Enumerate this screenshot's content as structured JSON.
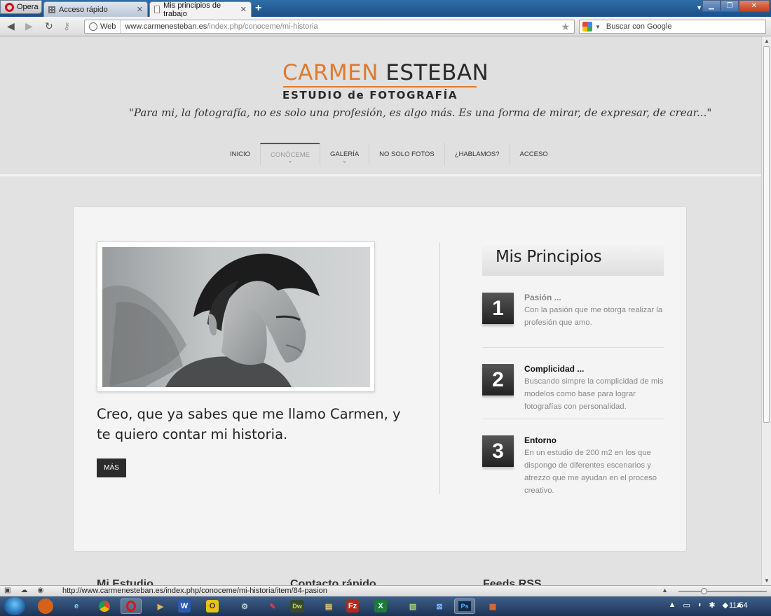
{
  "browser": {
    "menu_label": "Opera",
    "tabs": [
      {
        "label": "Acceso rápido"
      },
      {
        "label": "Mis principios de trabajo"
      }
    ],
    "address": {
      "badge": "Web",
      "url_host": "www.carmenesteban.es",
      "url_path": "/index.php/conoceme/mi-historia"
    },
    "search_placeholder": "Buscar con Google",
    "status_url": "http://www.carmenesteban.es/index.php/conoceme/mi-historia/item/84-pasion"
  },
  "site": {
    "logo_first": "CARMEN",
    "logo_last": "ESTEBAN",
    "logo_sub": "ESTUDIO de FOTOGRAFÍA",
    "tagline": "\"Para mi, la fotografía, no es solo una profesión, es algo más. Es una forma de mirar, de expresar, de crear...\"",
    "menu": [
      {
        "label": "INICIO"
      },
      {
        "label": "CONÓCEME"
      },
      {
        "label": "GALERÍA"
      },
      {
        "label": "NO SOLO FOTOS"
      },
      {
        "label": "¿HABLAMOS?"
      },
      {
        "label": "ACCESO"
      }
    ]
  },
  "main": {
    "intro": "Creo, que ya sabes que me llamo Carmen, y te quiero contar mi historia.",
    "more_button": "MÁS",
    "principles_title": "Mis Principios",
    "principles": [
      {
        "num": "1",
        "title": "Pasión ...",
        "text": "Con la pasión que me otorga realizar la profesión que amo."
      },
      {
        "num": "2",
        "title": "Complicidad ...",
        "text": "Buscando simpre la complicidad de mis modelos como base para lograr fotografías con personalidad."
      },
      {
        "num": "3",
        "title": "Entorno",
        "text": "En un estudio de 200 m2 en los que dispongo de diferentes escenarios y atrezzo que me ayudan en el proceso creativo."
      }
    ]
  },
  "footer": {
    "col1": "Mi Estudio",
    "col2": "Contacto rápido",
    "col3": "Feeds RSS"
  },
  "taskbar": {
    "clock": "11:54"
  },
  "colors": {
    "brand_orange": "#e07a2e",
    "dark": "#2a2a2a"
  }
}
